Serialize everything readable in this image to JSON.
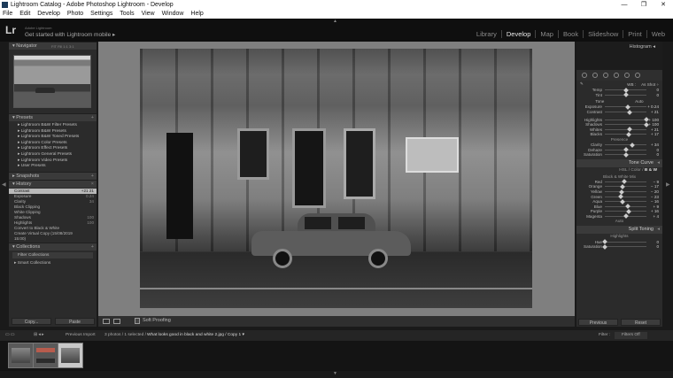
{
  "window": {
    "title": "Lightroom Catalog - Adobe Photoshop Lightroom - Develop",
    "controls": [
      "—",
      "❐",
      "✕"
    ]
  },
  "menu": [
    "File",
    "Edit",
    "Develop",
    "Photo",
    "Settings",
    "Tools",
    "View",
    "Window",
    "Help"
  ],
  "identity": {
    "logo": "Lr",
    "small": "Adobe Lightroom",
    "main": "Get started with Lightroom mobile ▸"
  },
  "modules": [
    "Library",
    "Develop",
    "Map",
    "Book",
    "Slideshow",
    "Print",
    "Web"
  ],
  "navigator": {
    "label": "Navigator",
    "zoom_options": [
      "FIT",
      "Fill",
      "1:1",
      "3:1"
    ]
  },
  "presets": {
    "label": "Presets",
    "items": [
      "▸ Lightroom B&W Filter Presets",
      "▸ Lightroom B&W Presets",
      "▸ Lightroom B&W Toned Presets",
      "▸ Lightroom Color Presets",
      "▸ Lightroom Effect Presets",
      "▸ Lightroom General Presets",
      "▸ Lightroom Video Presets",
      "▸ User Presets"
    ]
  },
  "snapshots": {
    "label": "Snapshots"
  },
  "history": {
    "label": "History",
    "items": [
      {
        "name": "Contrast",
        "a": "+21",
        "b": "21"
      },
      {
        "name": "Exposure",
        "a": "",
        "b": "0.24"
      },
      {
        "name": "Clarity",
        "a": "",
        "b": "34"
      },
      {
        "name": "Black Clipping",
        "a": "",
        "b": ""
      },
      {
        "name": "White Clipping",
        "a": "",
        "b": ""
      },
      {
        "name": "Shadows",
        "a": "",
        "b": "100"
      },
      {
        "name": "Highlights",
        "a": "",
        "b": "100"
      },
      {
        "name": "Convert to Black & White",
        "a": "",
        "b": ""
      },
      {
        "name": "Create Virtual Copy (15/08/2019 15:00)",
        "a": "",
        "b": ""
      }
    ]
  },
  "collections": {
    "label": "Collections",
    "filter": "Filter Collections",
    "items": [
      "▸ Smart Collections"
    ]
  },
  "left_buttons": {
    "copy": "Copy...",
    "paste": "Paste"
  },
  "toolbar": {
    "soft_proofing": "Soft Proofing"
  },
  "right": {
    "histogram": "Histogram",
    "wb": {
      "label": "WB :",
      "value": "As Shot ÷"
    },
    "temp_tint": [
      {
        "name": "Temp",
        "val": "0",
        "pos": 0.5
      },
      {
        "name": "Tint",
        "val": "0",
        "pos": 0.5
      }
    ],
    "tone_header": {
      "label": "Tone",
      "auto": "Auto"
    },
    "tone": [
      {
        "name": "Exposure",
        "val": "+ 0.24",
        "pos": 0.55
      },
      {
        "name": "Contrast",
        "val": "+ 21",
        "pos": 0.6
      }
    ],
    "tone2": [
      {
        "name": "Highlights",
        "val": "+ 100",
        "pos": 1.0
      },
      {
        "name": "Shadows",
        "val": "+ 100",
        "pos": 1.0
      },
      {
        "name": "Whites",
        "val": "+ 21",
        "pos": 0.6
      },
      {
        "name": "Blacks",
        "val": "+ 17",
        "pos": 0.58
      }
    ],
    "presence_label": "Presence",
    "presence": [
      {
        "name": "Clarity",
        "val": "+ 34",
        "pos": 0.67
      },
      {
        "name": "Dehaze",
        "val": "0",
        "pos": 0.5
      },
      {
        "name": "Saturation",
        "val": "0",
        "pos": 0.5
      }
    ],
    "tone_curve": "Tone Curve",
    "hsl_tabs": {
      "a": "HSL",
      "b": "Color",
      "c": "B & W"
    },
    "bw_mix_label": "Black & White Mix",
    "bw": [
      {
        "name": "Red",
        "val": "− 9",
        "pos": 0.46
      },
      {
        "name": "Orange",
        "val": "− 17",
        "pos": 0.42
      },
      {
        "name": "Yellow",
        "val": "− 20",
        "pos": 0.4
      },
      {
        "name": "Green",
        "val": "− 23",
        "pos": 0.38
      },
      {
        "name": "Aqua",
        "val": "− 16",
        "pos": 0.42
      },
      {
        "name": "Blue",
        "val": "+ 9",
        "pos": 0.55
      },
      {
        "name": "Purple",
        "val": "+ 16",
        "pos": 0.58
      },
      {
        "name": "Magenta",
        "val": "+ 4",
        "pos": 0.52
      }
    ],
    "auto": "Auto",
    "split_toning": "Split Toning",
    "highlights_label": "Highlights",
    "split": [
      {
        "name": "Hue",
        "val": "0",
        "pos": 0.0
      },
      {
        "name": "Saturation",
        "val": "0",
        "pos": 0.0
      }
    ],
    "buttons": {
      "previous": "Previous",
      "reset": "Reset"
    }
  },
  "filmstrip_bar": {
    "source": "Previous Import",
    "count": "3 photos / 1 selected /",
    "file": "What looks good in black and white 2.jpg / Copy 1 ▾",
    "filter_label": "Filter :",
    "filter_value": "Filters Off"
  }
}
